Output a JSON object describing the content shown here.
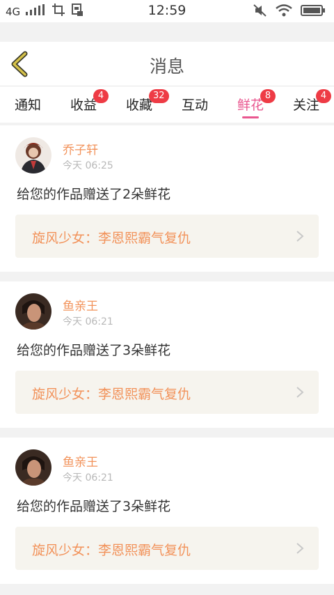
{
  "status_bar": {
    "network": "4G",
    "time": "12:59"
  },
  "header": {
    "title": "消息"
  },
  "tabs": [
    {
      "label": "通知",
      "badge": ""
    },
    {
      "label": "收益",
      "badge": "4"
    },
    {
      "label": "收藏",
      "badge": "32"
    },
    {
      "label": "互动",
      "badge": ""
    },
    {
      "label": "鲜花",
      "badge": "8",
      "active": true
    },
    {
      "label": "关注",
      "badge": "4"
    }
  ],
  "messages": [
    {
      "user": "乔子轩",
      "time": "今天 06:25",
      "text": "给您的作品赠送了2朵鲜花",
      "work": "旋风少女：李恩熙霸气复仇"
    },
    {
      "user": "鱼亲王",
      "time": "今天 06:21",
      "text": "给您的作品赠送了3朵鲜花",
      "work": "旋风少女：李恩熙霸气复仇"
    },
    {
      "user": "鱼亲王",
      "time": "今天 06:21",
      "text": "给您的作品赠送了3朵鲜花",
      "work": "旋风少女：李恩熙霸气复仇"
    }
  ],
  "colors": {
    "accent": "#e9578f",
    "name": "#f2925a",
    "badge": "#ee3b45",
    "link_bg": "#f6f4ee"
  }
}
